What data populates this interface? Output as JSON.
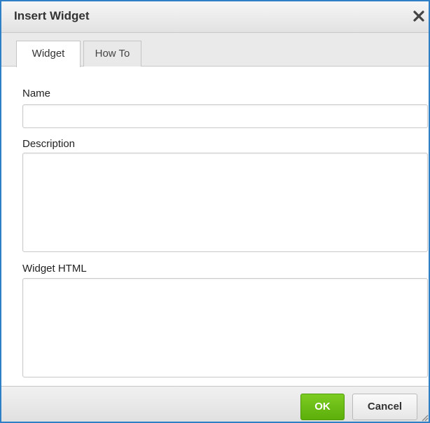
{
  "dialog": {
    "title": "Insert Widget",
    "close_icon": "close-icon"
  },
  "tabs": [
    {
      "label": "Widget",
      "active": true
    },
    {
      "label": "How To",
      "active": false
    }
  ],
  "form": {
    "name": {
      "label": "Name",
      "value": ""
    },
    "description": {
      "label": "Description",
      "value": ""
    },
    "widget_html": {
      "label": "Widget HTML",
      "value": ""
    }
  },
  "footer": {
    "ok_label": "OK",
    "cancel_label": "Cancel",
    "resize_icon": "resize-handle-icon"
  },
  "colors": {
    "border_accent": "#2f7fc6",
    "ok_button": "#6cbd15"
  }
}
